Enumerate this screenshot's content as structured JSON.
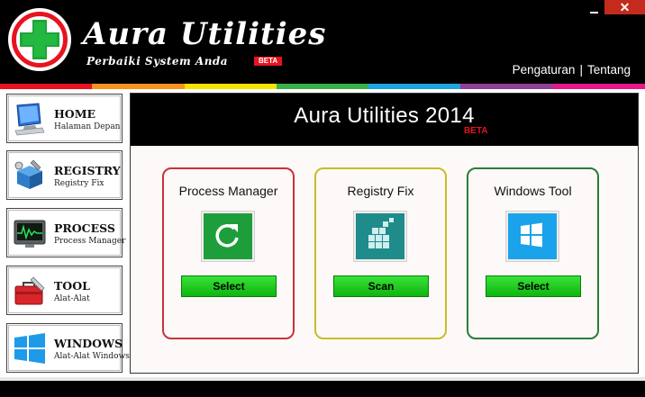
{
  "window": {
    "minimize_label": "—",
    "close_label": "✕"
  },
  "header": {
    "title": "Aura Utilities",
    "subtitle": "Perbaiki System Anda",
    "beta_tag": "BETA",
    "nav": [
      {
        "label": "Pengaturan"
      },
      {
        "label": "Tentang"
      }
    ],
    "nav_separator": "|"
  },
  "stripe_colors": [
    "#e8131f",
    "#f7931e",
    "#f5e400",
    "#37b34a",
    "#1ea6e1",
    "#8f3f97",
    "#e8178a"
  ],
  "sidebar": {
    "items": [
      {
        "label": "HOME",
        "sublabel": "Halaman Depan",
        "icon": "monitor-icon"
      },
      {
        "label": "REGISTRY",
        "sublabel": "Registry Fix",
        "icon": "registry-tools-icon"
      },
      {
        "label": "PROCESS",
        "sublabel": "Process Manager",
        "icon": "activity-monitor-icon"
      },
      {
        "label": "TOOL",
        "sublabel": "Alat-Alat",
        "icon": "toolbox-icon"
      },
      {
        "label": "WINDOWS",
        "sublabel": "Alat-Alat Windows",
        "icon": "windows-logo-icon"
      }
    ]
  },
  "main": {
    "title": "Aura Utilities 2014",
    "beta": "BETA",
    "cards": [
      {
        "title": "Process Manager",
        "button": "Select",
        "icon": "refresh-icon",
        "tile_color": "#1e9e3a"
      },
      {
        "title": "Registry Fix",
        "button": "Scan",
        "icon": "registry-cubes-icon",
        "tile_color": "#1f8b8a"
      },
      {
        "title": "Windows Tool",
        "button": "Select",
        "icon": "windows-logo-icon",
        "tile_color": "#1aa3ea"
      }
    ]
  }
}
